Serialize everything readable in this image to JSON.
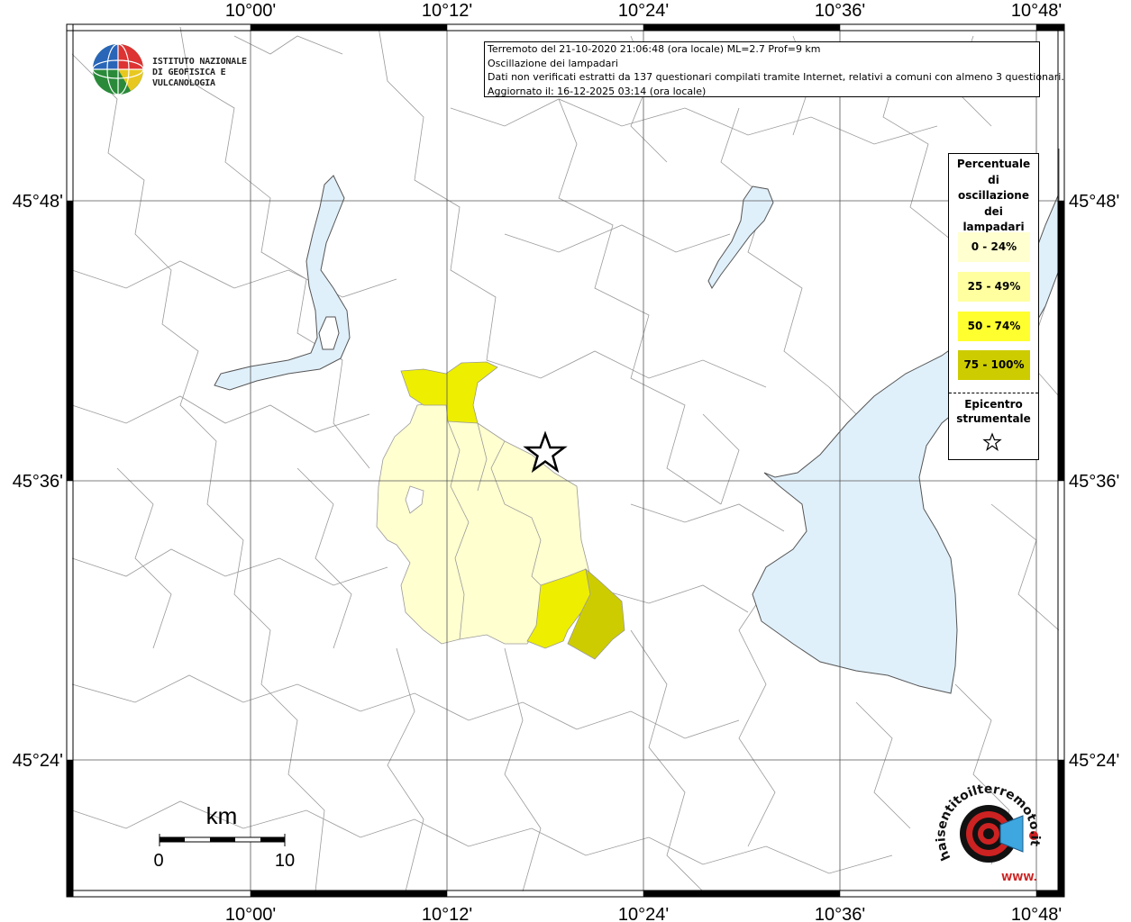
{
  "info_box": {
    "line1": "Terremoto del 21-10-2020 21:06:48 (ora locale) ML=2.7 Prof=9 km",
    "line2": "Oscillazione dei lampadari",
    "line3": "Dati non verificati estratti da 137 questionari compilati tramite Internet, relativi a comuni con almeno 3 questionari.",
    "line4": "Aggiornato il: 16-12-2025 03:14 (ora locale)"
  },
  "logo_ingv": {
    "line1": "ISTITUTO NAZIONALE",
    "line2": "DI GEOFISICA E VULCANOLOGIA"
  },
  "legend": {
    "title_lines": [
      "Percentuale",
      "di",
      "oscillazione",
      "dei",
      "lampadari"
    ],
    "classes": [
      {
        "label": "0 - 24%",
        "color": "#ffffd0"
      },
      {
        "label": "25 - 49%",
        "color": "#ffffa0"
      },
      {
        "label": "50 - 74%",
        "color": "#ffff30"
      },
      {
        "label": "75 - 100%",
        "color": "#cccc00"
      }
    ],
    "epicenter_line1": "Epicentro",
    "epicenter_line2": "strumentale"
  },
  "axes": {
    "lon_ticks": [
      "10°00'",
      "10°12'",
      "10°24'",
      "10°36'",
      "10°48'"
    ],
    "lat_ticks": [
      "45°48'",
      "45°36'",
      "45°24'"
    ]
  },
  "scale": {
    "unit": "km",
    "start": "0",
    "end": "10"
  },
  "logo_hst": {
    "text": "haisentitoilterremoto.it",
    "www": "WWW."
  },
  "colors": {
    "water": "#e0f0fb",
    "class_0_24": "#ffffd0",
    "class_50_74": "#eeee00",
    "class_75_100": "#cccc00"
  }
}
